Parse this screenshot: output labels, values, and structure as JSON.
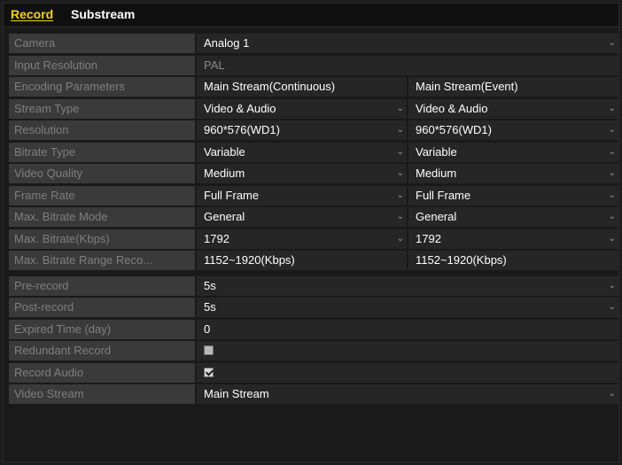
{
  "tabs": [
    {
      "label": "Record",
      "active": true
    },
    {
      "label": "Substream",
      "active": false
    }
  ],
  "rows": {
    "camera": {
      "label": "Camera",
      "value": "Analog 1"
    },
    "input_resolution": {
      "label": "Input Resolution",
      "value": "PAL"
    },
    "encoding_parameters": {
      "label": "Encoding Parameters",
      "main": "Main Stream(Continuous)",
      "event": "Main Stream(Event)"
    },
    "stream_type": {
      "label": "Stream Type",
      "main": "Video & Audio",
      "event": "Video & Audio"
    },
    "resolution": {
      "label": "Resolution",
      "main": "960*576(WD1)",
      "event": "960*576(WD1)"
    },
    "bitrate_type": {
      "label": "Bitrate Type",
      "main": "Variable",
      "event": "Variable"
    },
    "video_quality": {
      "label": "Video Quality",
      "main": "Medium",
      "event": "Medium"
    },
    "frame_rate": {
      "label": "Frame Rate",
      "main": "Full Frame",
      "event": "Full Frame"
    },
    "max_bitrate_mode": {
      "label": "Max. Bitrate Mode",
      "main": "General",
      "event": "General"
    },
    "max_bitrate": {
      "label": "Max. Bitrate(Kbps)",
      "main": "1792",
      "event": "1792"
    },
    "max_bitrate_range": {
      "label": "Max. Bitrate Range Reco...",
      "main": "1152~1920(Kbps)",
      "event": "1152~1920(Kbps)"
    },
    "pre_record": {
      "label": "Pre-record",
      "value": "5s"
    },
    "post_record": {
      "label": "Post-record",
      "value": "5s"
    },
    "expired_time": {
      "label": "Expired Time (day)",
      "value": "0"
    },
    "redundant_record": {
      "label": "Redundant Record",
      "checked": false
    },
    "record_audio": {
      "label": "Record Audio",
      "checked": true
    },
    "video_stream": {
      "label": "Video Stream",
      "value": "Main Stream"
    }
  },
  "icons": {
    "dropdown": "chevron-down-icon",
    "checkbox": "checkbox-icon"
  },
  "colors": {
    "active_tab": "#f3d21b",
    "label_bg": "#3a3a3a",
    "value_bg": "#262626"
  }
}
